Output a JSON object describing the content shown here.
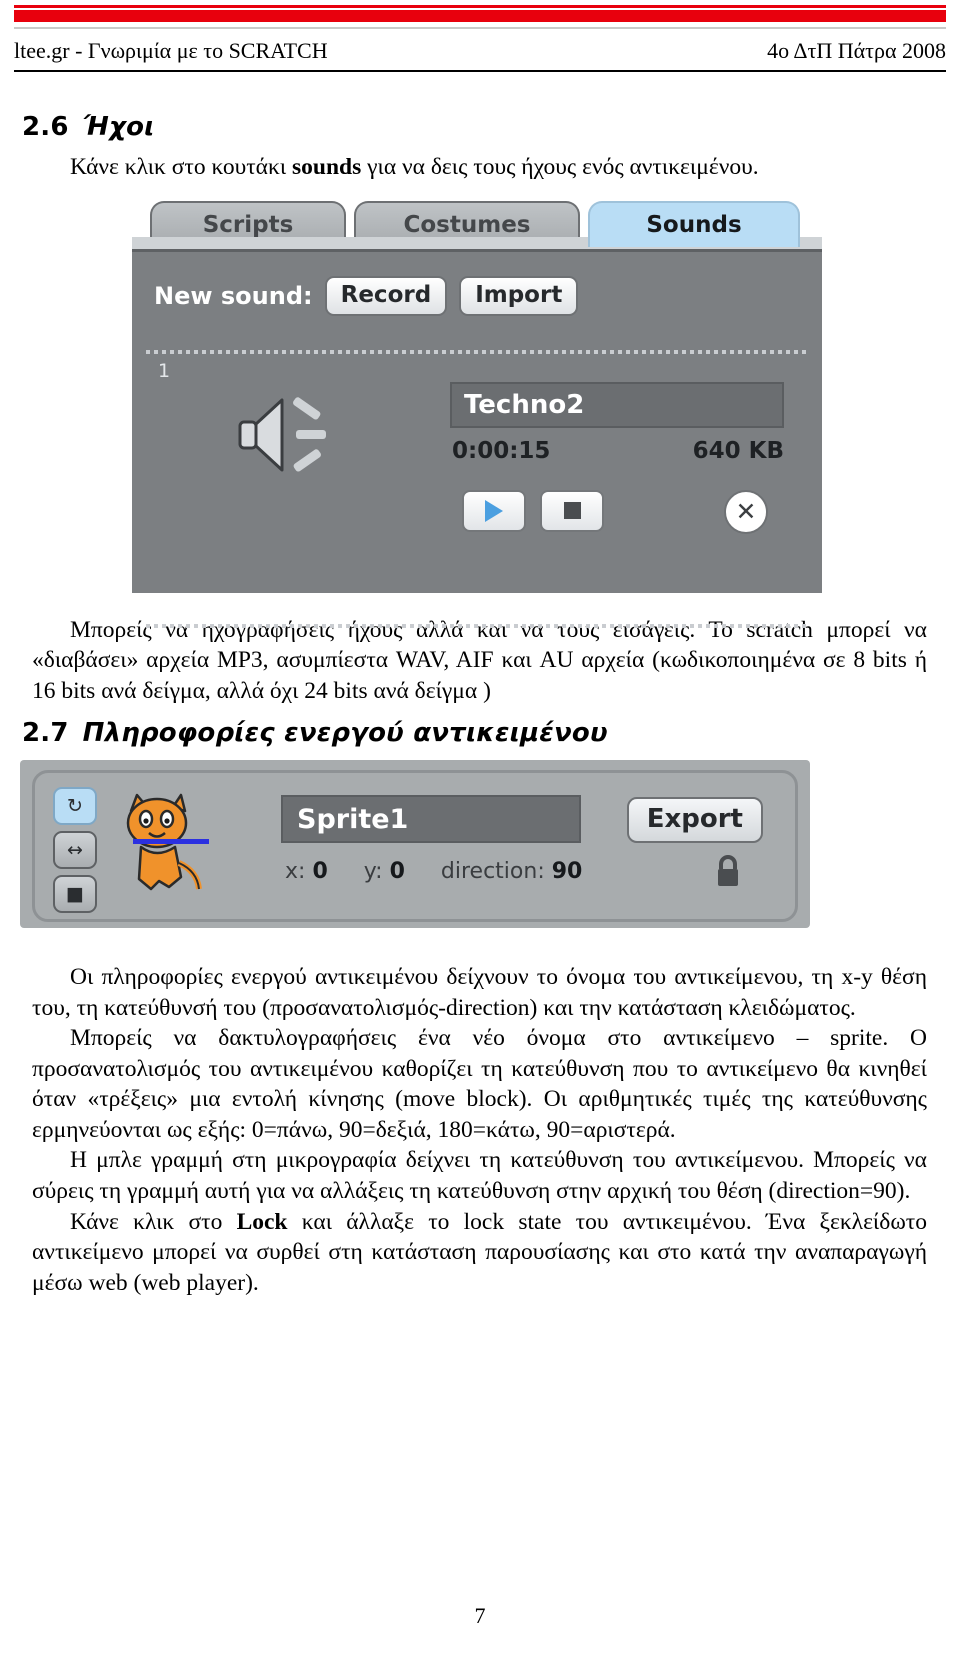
{
  "header": {
    "left": "ltee.gr - Γνωριμία με το SCRATCH",
    "right": "4ο ΔτΠ Πάτρα 2008"
  },
  "section_sounds": {
    "number": "2.6",
    "title": "Ήχοι",
    "intro_before": "Κάνε κλικ στο κουτάκι ",
    "intro_bold": "sounds",
    "intro_after": " για να δεις τους ήχους ενός αντικειμένου.",
    "paragraph": "Μπορείς να ηχογραφήσεις ήχους αλλά και να τους εισάγεις. Το scratch μπορεί να «διαβάσει» αρχεία MP3, ασυμπίεστα WAV, AIF και AU αρχεία (κωδικοποιημένα σε 8 bits ή 16 bits ανά δείγμα, αλλά όχι 24 bits ανά δείγμα )"
  },
  "sounds_panel": {
    "tabs": [
      {
        "label": "Scripts",
        "active": false
      },
      {
        "label": "Costumes",
        "active": false
      },
      {
        "label": "Sounds",
        "active": true
      }
    ],
    "new_sound_label": "New sound:",
    "record_button": "Record",
    "import_button": "Import",
    "sound_item": {
      "index": "1",
      "name": "Techno2",
      "duration": "0:00:15",
      "size": "640 KB",
      "play_button_name": "play",
      "stop_button_name": "stop",
      "delete_button_label": "✕"
    }
  },
  "section_sprite": {
    "number": "2.7",
    "title": "Πληροφορίες ενεργού αντικειμένου",
    "paragraphs": [
      "Οι πληροφορίες ενεργού αντικειμένου  δείχνουν το όνομα του αντικείμενου, τη x-y θέση του, τη κατεύθυνσή του (προσανατολισμός-direction) και την κατάσταση κλειδώματος.",
      "Μπορείς να δακτυλογραφήσεις ένα νέο όνομα στο αντικείμενο – sprite. Ο προσανατολισμός του αντικειμένου καθορίζει τη κατεύθυνση που το αντικείμενο θα κινηθεί όταν «τρέξεις» μια εντολή κίνησης (move block). Οι αριθμητικές τιμές της κατεύθυνσης ερμηνεύονται ως εξής:  0=πάνω,  90=δεξιά, 180=κάτω, 90=αριστερά.",
      "Η μπλε γραμμή στη μικρογραφία δείχνει τη κατεύθυνση του αντικείμενου. Μπορείς να σύρεις τη γραμμή αυτή για να αλλάξεις τη κατεύθυνση στην αρχική του θέση (direction=90)."
    ],
    "last_paragraph": {
      "before": "Κάνε κλικ στο ",
      "bold": "Lock",
      "after": " και άλλαξε το lock state του αντικειμένου. Ένα ξεκλείδωτο αντικείμενο μπορεί να συρθεί στη κατάσταση παρουσίασης και στο κατά την αναπαραγωγή μέσω web (web player)."
    }
  },
  "sprite_panel": {
    "rotation_buttons": [
      {
        "name": "rotate-freely",
        "glyph": "↻",
        "selected": true
      },
      {
        "name": "left-right-flip",
        "glyph": "↔",
        "selected": false
      },
      {
        "name": "no-rotate",
        "glyph": "■",
        "selected": false
      }
    ],
    "sprite_name": "Sprite1",
    "export_button": "Export",
    "stats": {
      "x_label": "x:",
      "x_value": "0",
      "y_label": "y:",
      "y_value": "0",
      "direction_label": "direction:",
      "direction_value": "90"
    },
    "lock_icon_name": "lock-icon"
  },
  "page_number": "7",
  "colors": {
    "accent_red": "#e8000d",
    "panel_grey": "#7c7f82",
    "tab_active_blue": "#b9ddf5",
    "direction_line_blue": "#2b30e0"
  }
}
